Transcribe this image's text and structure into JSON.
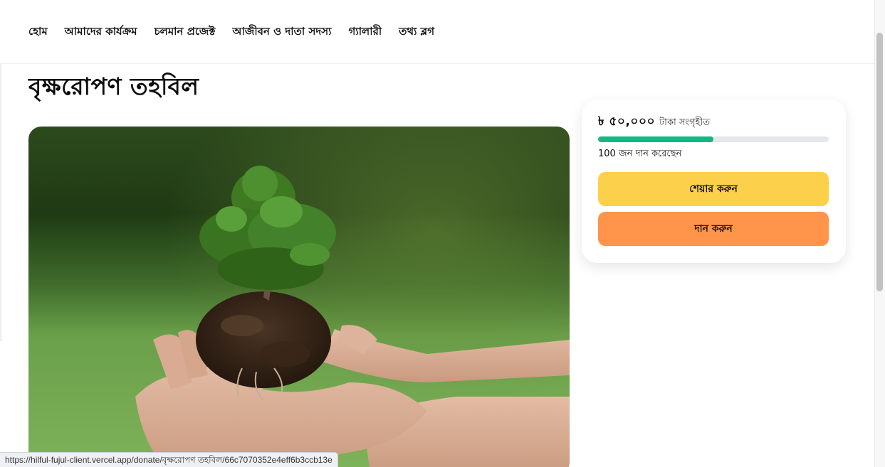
{
  "nav": {
    "items": [
      {
        "label": "হোম"
      },
      {
        "label": "আমাদের কার্যক্রম"
      },
      {
        "label": "চলমান প্রজেক্ট"
      },
      {
        "label": "আজীবন ও দাতা সদস্য"
      },
      {
        "label": "গ্যালারী"
      },
      {
        "label": "তথ্য ব্লগ"
      }
    ]
  },
  "page": {
    "title": "বৃক্ষরোপণ তহবিল"
  },
  "hero": {
    "image_subject": "hands holding a small tree sapling with soil"
  },
  "donation": {
    "raised_amount": "৳ ৫০,০০০",
    "raised_unit": "টাকা সংগৃহীত",
    "progress_fraction": 0.5,
    "donor_count_text": "100 জন দান করেছেন",
    "share_label": "শেয়ার করুন",
    "donate_label": "দান করুন"
  },
  "colors": {
    "progress": "#10b981",
    "share_button": "#fcd04b",
    "donate_button": "#ff944a"
  },
  "status_bar": {
    "url": "https://hilful-fujul-client.vercel.app/donate/বৃক্ষরোপণ তহবিল/66c7070352e4eff6b3ccb13e"
  }
}
